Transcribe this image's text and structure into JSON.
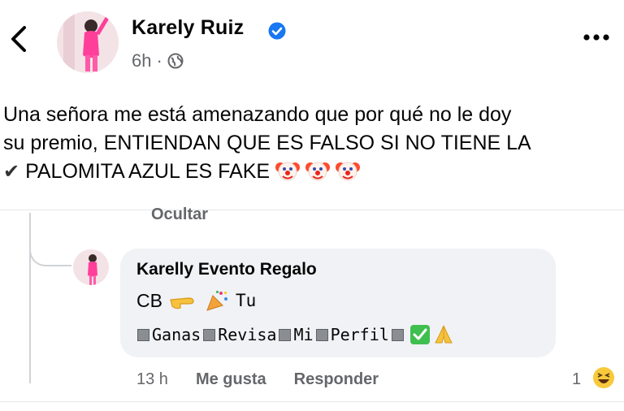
{
  "header": {
    "back_icon": "chevron-left-icon",
    "author": "Karely Ruiz",
    "verified_icon": "verified-badge-icon",
    "time": "6h",
    "separator": "·",
    "audience_icon": "globe-icon",
    "more_icon": "more-dots-icon"
  },
  "post": {
    "line1": "Una señora me está amenazando que por qué no le doy",
    "line2": "su premio, ENTIENDAN QUE ES FALSO SI NO TIENE LA",
    "line3_check": "✔",
    "line3_text": "PALOMITA AZUL ES FAKE",
    "emojis": [
      "clown-face",
      "clown-face",
      "clown-face"
    ]
  },
  "hide_label": "Ocultar",
  "comment": {
    "author": "Karelly Evento Regalo",
    "line1_text": "CB",
    "line1_suffix": "Tu",
    "line2_words": [
      "Ganas",
      "Revisa",
      "Mi",
      "Perfil"
    ],
    "time": "13 h",
    "like_label": "Me gusta",
    "reply_label": "Responder",
    "reaction_count": "1",
    "reaction_icon": "laughing-emoji"
  },
  "colors": {
    "verified": "#1877f2",
    "muted": "#65676b",
    "bubble": "#f0f2f5",
    "accent_pink": "#ff4fa3"
  }
}
